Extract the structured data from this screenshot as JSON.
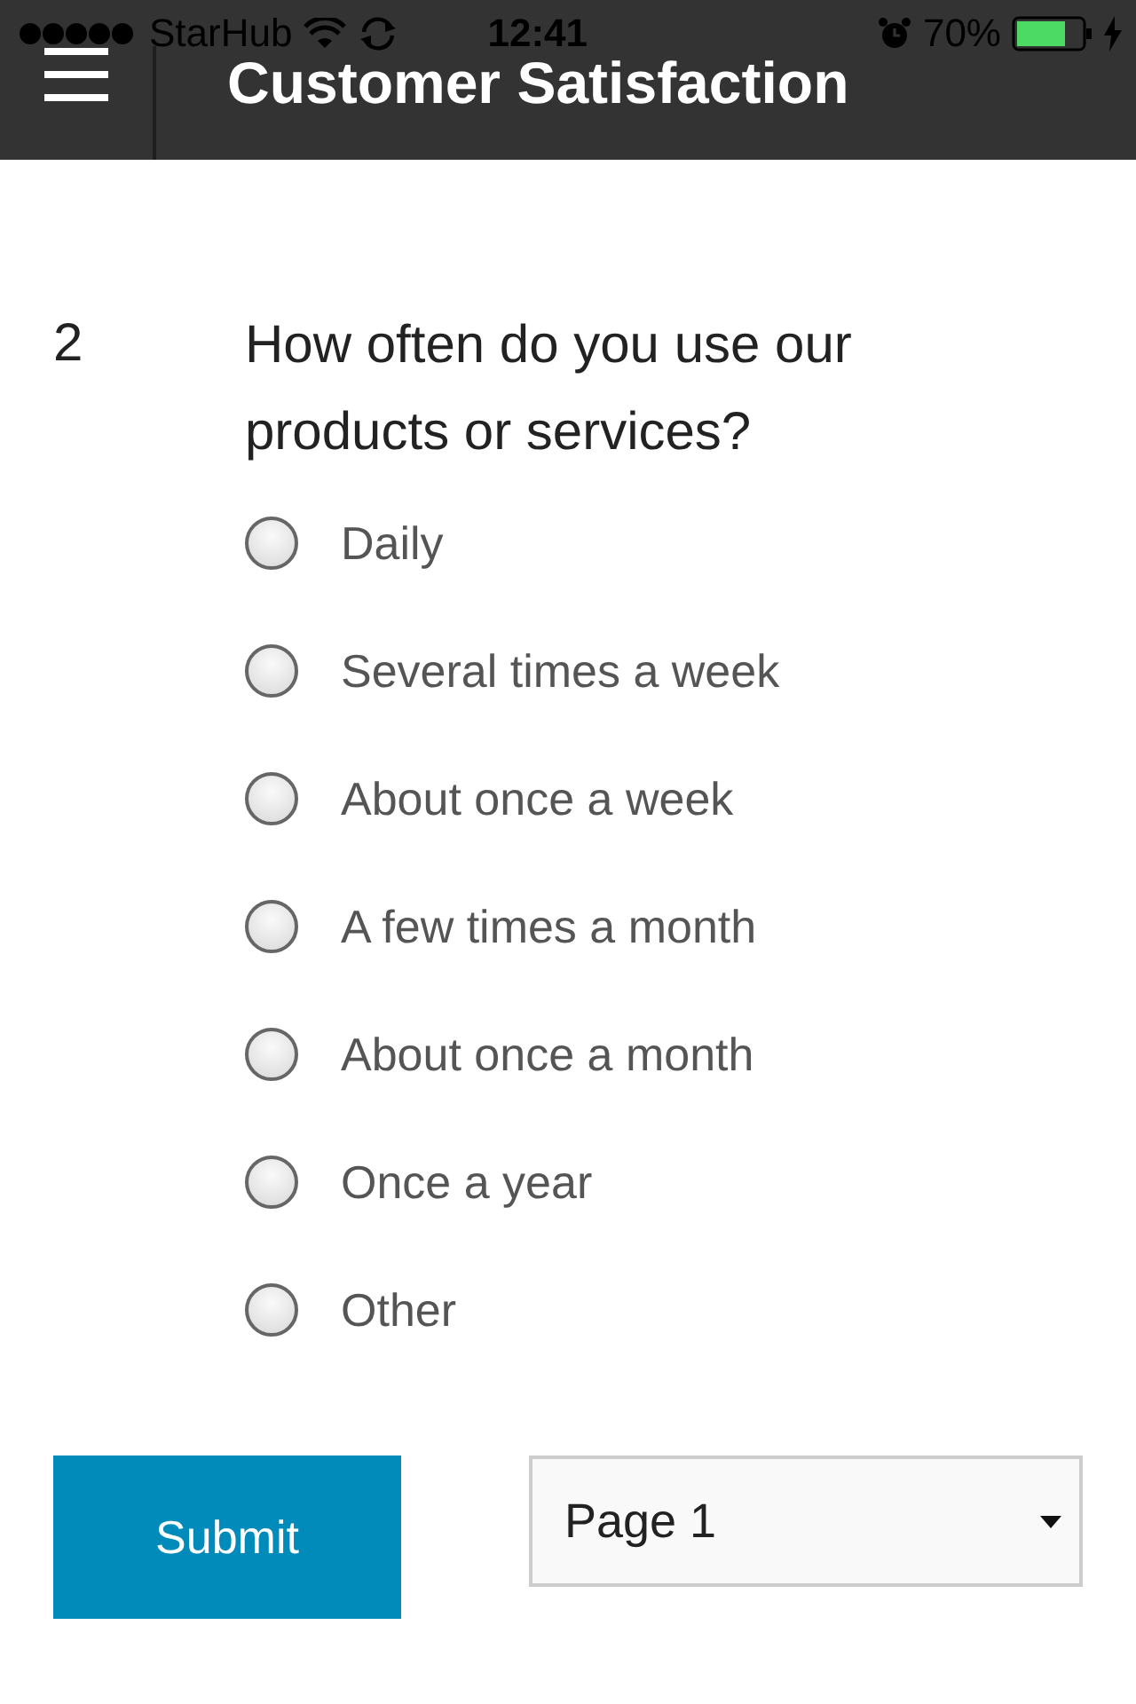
{
  "status_bar": {
    "carrier": "StarHub",
    "time": "12:41",
    "battery": "70%"
  },
  "header": {
    "title": "Customer Satisfaction"
  },
  "question": {
    "number": "2",
    "text": "How often do you use our products or services?",
    "options": [
      {
        "label": "Daily",
        "selected": false
      },
      {
        "label": "Several times a week",
        "selected": false
      },
      {
        "label": "About once a week",
        "selected": false
      },
      {
        "label": "A few times a month",
        "selected": false
      },
      {
        "label": "About once a month",
        "selected": false
      },
      {
        "label": "Once a year",
        "selected": false
      },
      {
        "label": "Other",
        "selected": false
      }
    ]
  },
  "footer": {
    "submit": "Submit",
    "page_select": "Page 1"
  }
}
